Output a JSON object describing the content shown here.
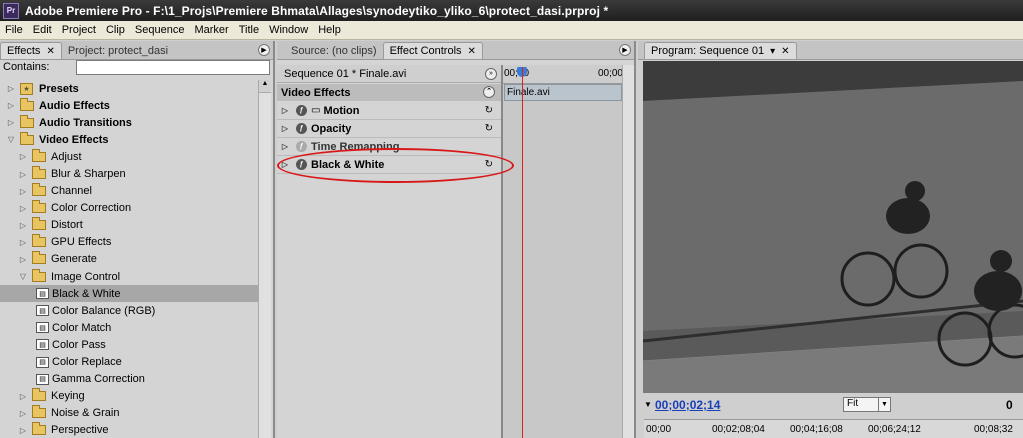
{
  "window": {
    "title": "Adobe Premiere Pro - F:\\1_Projs\\Premiere Bhmata\\Allages\\synodeytiko_yliko_6\\protect_dasi.prproj *",
    "app_icon": "Pr"
  },
  "menu": [
    "File",
    "Edit",
    "Project",
    "Clip",
    "Sequence",
    "Marker",
    "Title",
    "Window",
    "Help"
  ],
  "effects_panel": {
    "tabs": [
      {
        "label": "Effects"
      },
      {
        "label": "Project: protect_dasi"
      }
    ],
    "contains_label": "Contains:",
    "contains_value": "",
    "tree": [
      {
        "label": "Presets",
        "type": "presets",
        "level": 0,
        "expanded": false,
        "bold": true
      },
      {
        "label": "Audio Effects",
        "type": "folder",
        "level": 0,
        "expanded": false,
        "bold": true
      },
      {
        "label": "Audio Transitions",
        "type": "folder",
        "level": 0,
        "expanded": false,
        "bold": true
      },
      {
        "label": "Video Effects",
        "type": "folder",
        "level": 0,
        "expanded": true,
        "bold": true
      },
      {
        "label": "Adjust",
        "type": "folder",
        "level": 1,
        "expanded": false
      },
      {
        "label": "Blur & Sharpen",
        "type": "folder",
        "level": 1,
        "expanded": false
      },
      {
        "label": "Channel",
        "type": "folder",
        "level": 1,
        "expanded": false
      },
      {
        "label": "Color Correction",
        "type": "folder",
        "level": 1,
        "expanded": false
      },
      {
        "label": "Distort",
        "type": "folder",
        "level": 1,
        "expanded": false
      },
      {
        "label": "GPU Effects",
        "type": "folder",
        "level": 1,
        "expanded": false
      },
      {
        "label": "Generate",
        "type": "folder",
        "level": 1,
        "expanded": false
      },
      {
        "label": "Image Control",
        "type": "folder",
        "level": 1,
        "expanded": true
      },
      {
        "label": "Black & White",
        "type": "effect",
        "level": 2,
        "selected": true
      },
      {
        "label": "Color Balance (RGB)",
        "type": "effect",
        "level": 2
      },
      {
        "label": "Color Match",
        "type": "effect",
        "level": 2
      },
      {
        "label": "Color Pass",
        "type": "effect",
        "level": 2
      },
      {
        "label": "Color Replace",
        "type": "effect",
        "level": 2
      },
      {
        "label": "Gamma Correction",
        "type": "effect",
        "level": 2
      },
      {
        "label": "Keying",
        "type": "folder",
        "level": 1,
        "expanded": false
      },
      {
        "label": "Noise & Grain",
        "type": "folder",
        "level": 1,
        "expanded": false
      },
      {
        "label": "Perspective",
        "type": "folder",
        "level": 1,
        "expanded": false
      }
    ]
  },
  "effect_controls": {
    "tabs": [
      {
        "label": "Source: (no clips)"
      },
      {
        "label": "Effect Controls"
      }
    ],
    "sequence_label": "Sequence 01 * Finale.avi",
    "section_title": "Video Effects",
    "effects": [
      {
        "label": "Motion",
        "has_film_icon": true,
        "enabled": true
      },
      {
        "label": "Opacity",
        "enabled": true
      },
      {
        "label": "Time Remapping",
        "enabled": false
      },
      {
        "label": "Black & White",
        "enabled": true
      }
    ],
    "ruler_start": "00;00",
    "ruler_end": "00;00",
    "clip_label": "Finale.avi"
  },
  "program_monitor": {
    "tab_label": "Program: Sequence 01",
    "timecode": "00;00;02;14",
    "zoom": "Fit",
    "timecode_right": "0",
    "ruler_ticks": [
      "00;00",
      "00;02;08;04",
      "00;04;16;08",
      "00;06;24;12",
      "00;08;32"
    ]
  },
  "colors": {
    "accent_annotation": "#d81818",
    "timecode": "#1a3fb8",
    "playhead": "#e02020"
  }
}
